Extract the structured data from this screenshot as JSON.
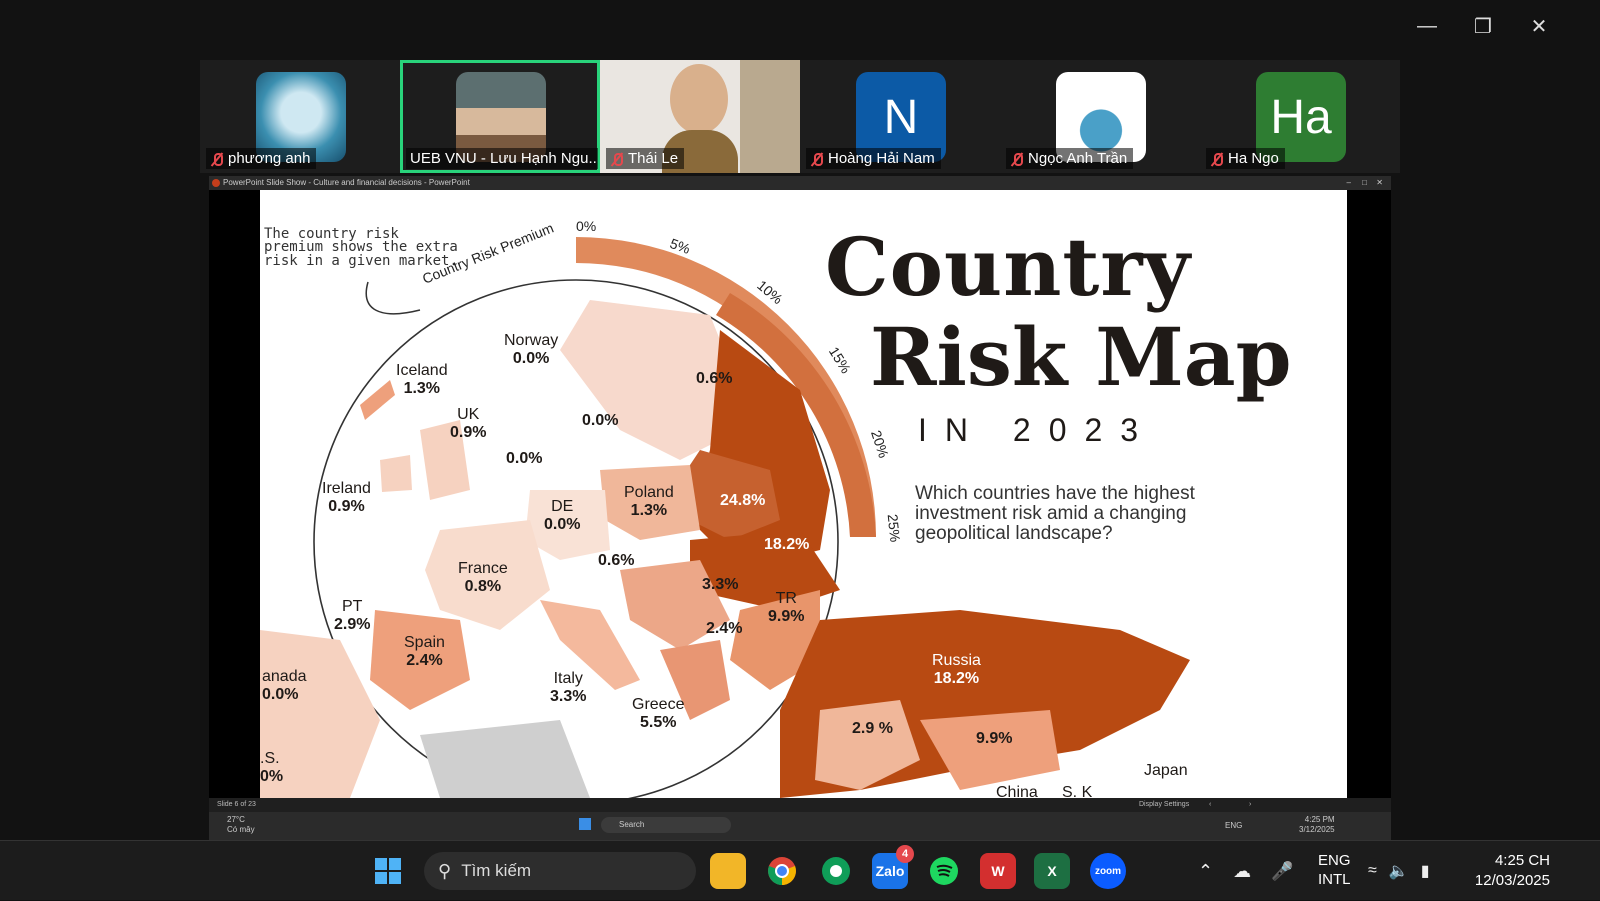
{
  "participants": [
    {
      "name": "phương anh",
      "muted": true,
      "avatar": "photo",
      "active": false
    },
    {
      "name": "UEB VNU - Lưu Hạnh Ngu...",
      "muted": false,
      "avatar": "photo",
      "active": true
    },
    {
      "name": "Thái Le",
      "muted": true,
      "avatar": "video",
      "active": false
    },
    {
      "name": "Hoàng Hải Nam",
      "muted": true,
      "avatar": "N",
      "active": false
    },
    {
      "name": "Ngọc Anh Trần",
      "muted": true,
      "avatar": "photo",
      "active": false
    },
    {
      "name": "Ha Ngo",
      "muted": true,
      "avatar": "Ha",
      "active": false
    }
  ],
  "share": {
    "window_title": "PowerPoint Slide Show - Culture and financial decisions - PowerPoint",
    "status_left": "Slide 6 of 23",
    "status_right": "Display Settings",
    "inner_taskbar": {
      "weather_temp": "27°C",
      "weather_desc": "Có mây",
      "search": "Search",
      "lang": "ENG",
      "time": "4:25 PM",
      "date": "3/12/2025"
    }
  },
  "slide": {
    "title_line1": "Country",
    "title_line2": "Risk Map",
    "title_year": "IN 2023",
    "question": "Which countries have the highest investment risk amid a changing geopolitical landscape?",
    "intro": "The country risk premium shows the extra risk in a given market.",
    "arc_label": "Country Risk Premium",
    "scale": [
      "0%",
      "5%",
      "10%",
      "15%",
      "20%",
      "25%"
    ],
    "countries": [
      {
        "name": "Norway",
        "value": "0.0%"
      },
      {
        "name": "Iceland",
        "value": "1.3%"
      },
      {
        "name": "UK",
        "value": "0.9%"
      },
      {
        "name": "Ireland",
        "value": "0.9%"
      },
      {
        "name": "DE",
        "value": "0.0%"
      },
      {
        "name": "Poland",
        "value": "1.3%"
      },
      {
        "name": "France",
        "value": "0.8%"
      },
      {
        "name": "PT",
        "value": "2.9%"
      },
      {
        "name": "Spain",
        "value": "2.4%"
      },
      {
        "name": "Italy",
        "value": "3.3%"
      },
      {
        "name": "Greece",
        "value": "5.5%"
      },
      {
        "name": "TR",
        "value": "9.9%"
      },
      {
        "name": "Russia",
        "value": "18.2%"
      },
      {
        "name": "anada",
        "value": "0.0%"
      },
      {
        "name": "Japan",
        "value": ""
      }
    ],
    "unlabeled_values": [
      "0.6%",
      "0.0%",
      "0.0%",
      "24.8%",
      "18.2%",
      "0.6%",
      "3.3%",
      "2.4%",
      "2.9 %",
      "9.9%"
    ],
    "fragments": {
      "us": ".S.",
      "us_val": "0%",
      "china": "China",
      "korea": "S. K"
    }
  },
  "taskbar": {
    "search_placeholder": "Tìm kiếm",
    "zalo_badge": "4",
    "lang1": "ENG",
    "lang2": "INTL",
    "time": "4:25 CH",
    "date": "12/03/2025"
  },
  "colors": {
    "accent_green": "#29d37b",
    "risk_dark": "#b84a12",
    "risk_mid": "#e8956b",
    "risk_light": "#f6d2c0"
  }
}
